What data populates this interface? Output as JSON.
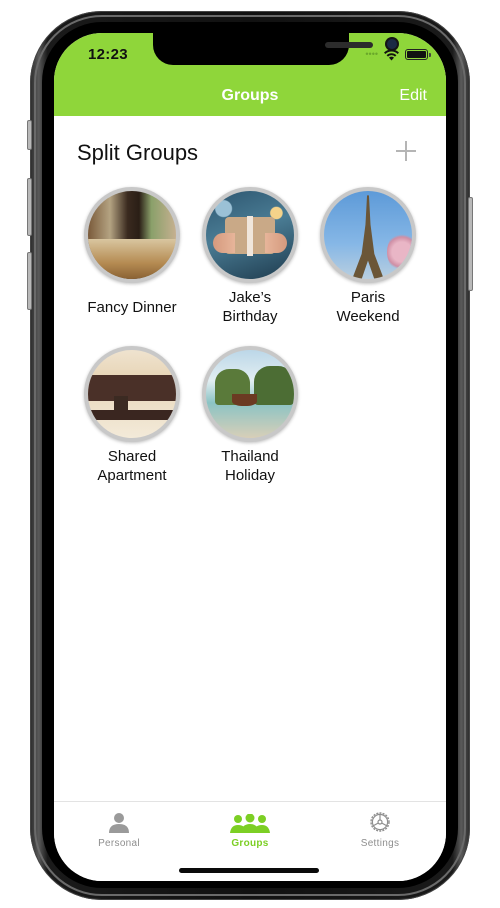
{
  "status_bar": {
    "time": "12:23",
    "signal_icon": "cellular-signal-dots",
    "wifi_icon": "wifi-icon",
    "battery_icon": "battery-icon"
  },
  "nav_bar": {
    "title": "Groups",
    "edit_label": "Edit",
    "background_color": "#8fd63a"
  },
  "section": {
    "title": "Split Groups",
    "add_icon": "plus-icon"
  },
  "groups": [
    {
      "label": "Fancy Dinner",
      "image": "restaurant-table-photo"
    },
    {
      "label_line1": "Jake’s",
      "label_line2": "Birthday",
      "image": "gift-box-hands-photo"
    },
    {
      "label_line1": "Paris",
      "label_line2": "Weekend",
      "image": "eiffel-tower-photo"
    },
    {
      "label_line1": "Shared",
      "label_line2": "Apartment",
      "image": "living-room-photo"
    },
    {
      "label_line1": "Thailand",
      "label_line2": "Holiday",
      "image": "thailand-longtail-boat-photo"
    }
  ],
  "tab_bar": {
    "tabs": [
      {
        "label": "Personal",
        "icon": "person-icon",
        "active": false
      },
      {
        "label": "Groups",
        "icon": "group-icon",
        "active": true
      },
      {
        "label": "Settings",
        "icon": "gear-icon",
        "active": false
      }
    ],
    "active_color": "#7ccf24",
    "inactive_color": "#8e8e8e"
  }
}
